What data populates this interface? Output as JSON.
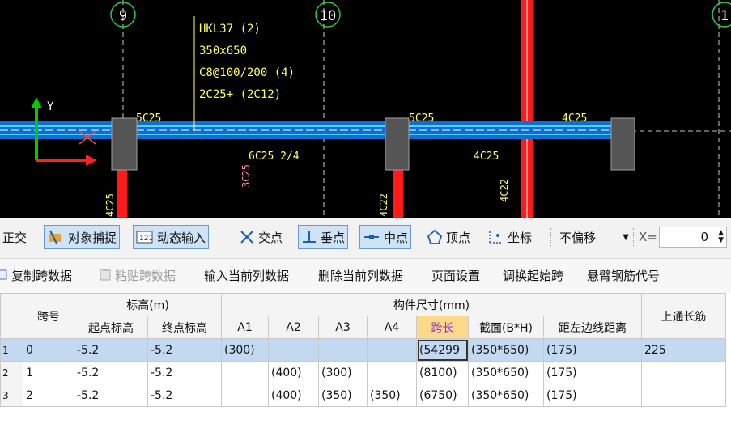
{
  "cad": {
    "axis_labels": [
      "9",
      "10",
      "1"
    ],
    "beam_label": [
      "HKL37 (2)",
      "350x650",
      "C8@100/200 (4)",
      "2C25+ (2C12)"
    ],
    "rebar_labels": [
      "5C25",
      "5C25",
      "4C25",
      "4C25",
      "6C25 2/4",
      "3C25",
      "4C25",
      "4C22",
      "4C22"
    ],
    "y_axis_label": "Y",
    "colors": {
      "beam": "#1e90ff",
      "column": "#555555",
      "red_bar": "#ff1a1a",
      "text": "#ffff66",
      "axis": "#00cc00"
    }
  },
  "snapbar": {
    "ortho": "正交",
    "object_snap": "对象捕捉",
    "dynamic_input": "动态输入",
    "intersection": "交点",
    "perpendicular": "垂点",
    "midpoint": "中点",
    "vertex": "顶点",
    "coordinate": "坐标",
    "offset_value": "不偏移",
    "x_label": "X=",
    "x_value": "0"
  },
  "menubar": {
    "copy": "复制跨数据",
    "paste": "粘贴跨数据",
    "input_col": "输入当前列数据",
    "delete_col": "删除当前列数据",
    "page_setup": "页面设置",
    "swap_start": "调换起始跨",
    "cantilever": "悬臂钢筋代号"
  },
  "table": {
    "h_span_no": "跨号",
    "h_elev": "标高(m)",
    "h_dims": "构件尺寸(mm)",
    "h_top": "上通长筋",
    "h_start_elev": "起点标高",
    "h_end_elev": "终点标高",
    "h_a1": "A1",
    "h_a2": "A2",
    "h_a3": "A3",
    "h_a4": "A4",
    "h_span_len": "跨长",
    "h_section": "截面(B*H)",
    "h_left_dist": "距左边线距离",
    "rows": [
      {
        "n": "1",
        "span": "0",
        "start": "-5.2",
        "end": "-5.2",
        "a1": "(300)",
        "a2": "",
        "a3": "",
        "a4": "",
        "len": "(54299",
        "sec": "(350*650)",
        "dist": "(175)",
        "top": "2⁤25"
      },
      {
        "n": "2",
        "span": "1",
        "start": "-5.2",
        "end": "-5.2",
        "a1": "",
        "a2": "(400)",
        "a3": "(300)",
        "a4": "",
        "len": "(8100)",
        "sec": "(350*650)",
        "dist": "(175)",
        "top": ""
      },
      {
        "n": "3",
        "span": "2",
        "start": "-5.2",
        "end": "-5.2",
        "a1": "",
        "a2": "(400)",
        "a3": "(350)",
        "a4": "(350)",
        "len": "(6750)",
        "sec": "(350*650)",
        "dist": "(175)",
        "top": ""
      }
    ]
  }
}
